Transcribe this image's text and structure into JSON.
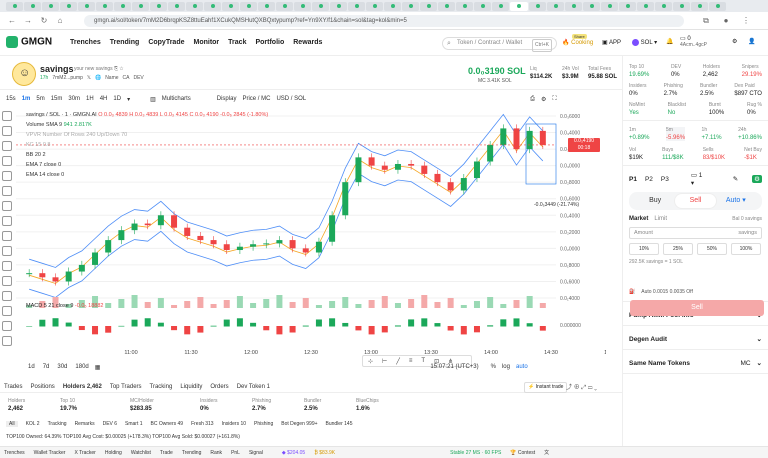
{
  "browser": {
    "url": "gmgn.ai/sol/token/7mM2D6brqpKSZ8ttuEahf1XCukQMSHutQXBQxtypump?ref=Yn9XY/f1&chain=sol&tag=kol&min=5",
    "tab_count": 40
  },
  "header": {
    "logo": "GMGN",
    "nav": [
      "Trenches",
      "Trending",
      "CopyTrade",
      "Monitor",
      "Track",
      "Portfolio",
      "Rewards"
    ],
    "search_placeholder": "Token / Contract / Wallet",
    "search_shortcut": "Ctrl+K",
    "cooking": "Cooking",
    "cooking_badge": "Share",
    "app": "APP",
    "chain": "SOL",
    "wallet_balance": "0",
    "wallet_name": "4Acm..4gcP"
  },
  "token": {
    "symbol": "savings",
    "description": "your new savings",
    "age": "17h",
    "creator": "7mM2...pump",
    "tags": [
      "Name",
      "CA",
      "DEV"
    ],
    "price": "0.0₀3190 SOL",
    "mc": "MC 3.41K SOL",
    "liq_label": "Liq",
    "liq": "$114.2K",
    "vol_label": "24h Vol",
    "vol": "$3.9M",
    "fees_label": "Total Fees",
    "fees": "95.88 SOL"
  },
  "chart": {
    "intervals": [
      "15s",
      "1m",
      "5m",
      "15m",
      "30m",
      "1H",
      "4H",
      "1D"
    ],
    "active_interval": "1m",
    "indicators_btn": "Multicharts",
    "display_btn": "Display",
    "price_mc": "Price / MC",
    "currency": "USD / SOL",
    "pair_line": "savings / SOL · 1 · GMGN.AI",
    "ohlc": "O 0.0₃ 4839  H 0.0₃ 4839  L 0.0₃ 4145  C 0.0₃ 4190  -0.0₆ 2845 (-1.80%)",
    "volume_label": "Volume SMA 9",
    "volume_vals": "941  2.817K",
    "vpvr_label": "VPVR Number Of Rows 240 Up/Down 70",
    "kc_label": "KC 15 0.8",
    "bb_label": "BB 20 2",
    "ema7_label": "EMA 7 close 0",
    "ema14_label": "EMA 14 close 0",
    "macd_label": "MACD 5 21 close 9",
    "macd_val": "-0.0₆ 18882",
    "price_badge_price": "0.0₃4190",
    "price_badge_time": "00:18",
    "annotation": "-0.0₅3449 (-21.74%)",
    "y_ticks": [
      "0.0₃6000",
      "0.0₃4000",
      "0.0₃2000",
      "0.0₃0000",
      "0.0₂8000",
      "0.0₂6000",
      "0.0₂4000",
      "0.0₂2000",
      "0.0₂0000",
      "0.0₁8000",
      "0.0₁6000",
      "0.0₁4000"
    ],
    "macd_tick": "0.000000",
    "x_ticks": [
      "11:00",
      "11:30",
      "12:00",
      "12:30",
      "13:00",
      "13:30",
      "14:00",
      "14:30",
      "15:00"
    ],
    "ranges": [
      "1d",
      "7d",
      "30d",
      "180d"
    ],
    "clock": "15:07:21 (UTC+3)",
    "scale_opts": [
      "%",
      "log",
      "auto"
    ],
    "price_points": [
      1.7e-06,
      1.65e-06,
      1.6e-06,
      1.72e-06,
      1.8e-06,
      1.95e-06,
      2.1e-06,
      2.22e-06,
      2.3e-06,
      2.28e-06,
      2.4e-06,
      2.25e-06,
      2.15e-06,
      2.1e-06,
      2.05e-06,
      1.98e-06,
      2.02e-06,
      2.05e-06,
      2.06e-06,
      2.1e-06,
      2e-06,
      1.95e-06,
      2.08e-06,
      2.4e-06,
      2.8e-06,
      3.1e-06,
      3e-06,
      2.95e-06,
      3.02e-06,
      3e-06,
      2.9e-06,
      2.8e-06,
      2.7e-06,
      2.85e-06,
      3.05e-06,
      3.25e-06,
      3.45e-06,
      3.2e-06,
      3.42e-06,
      3.25e-06
    ]
  },
  "bottom": {
    "tabs": [
      "Trades",
      "Positions",
      "Holders 2,462",
      "Top Traders",
      "Tracking",
      "Liquidity",
      "Orders",
      "Dev Token 1"
    ],
    "active_tab": "Holders 2,462",
    "instant_trade": "Instant trade",
    "stats": [
      {
        "label": "Holders",
        "value": "2,462"
      },
      {
        "label": "Top 10",
        "value": "19.7%"
      },
      {
        "label": "MC/Holder",
        "value": "$283.85"
      },
      {
        "label": "Insiders",
        "value": "0%"
      },
      {
        "label": "Phishing",
        "value": "2.7%"
      },
      {
        "label": "Bundler",
        "value": "2.5%"
      },
      {
        "label": "BlueChips",
        "value": "1.6%"
      }
    ],
    "filters": [
      "All",
      "KOL 2",
      "Tracking",
      "Remarks",
      "DEV 6",
      "Smart 1",
      "BC Owners 49",
      "Fresh 313",
      "Insiders 10",
      "Phishing",
      "Bot Degen 999+",
      "Bundler 145"
    ],
    "footer": "TOP100 Owned: 64.39%  TOP100 Avg Cost: $0.00025 (+178.3%)  TOP100 Avg Sold: $0.00027 (+161.8%)"
  },
  "status_bar": {
    "items": [
      "Trenches",
      "Wallet Tracker",
      "X Tracker",
      "Holding",
      "Watchlist",
      "Trade",
      "Trending",
      "Rank",
      "PnL",
      "Signal"
    ],
    "sol_price": "$204.05",
    "btc": "$83.9K",
    "stable": "Stable 27 MS · 60 FPS",
    "contest": "Contest",
    "lang": "文"
  },
  "right_panel": {
    "top_stats": [
      {
        "label": "Top 10",
        "value": "19.69%",
        "color": "green"
      },
      {
        "label": "DEV",
        "value": "0%"
      },
      {
        "label": "Holders",
        "value": "2,462"
      },
      {
        "label": "Snipers",
        "value": "29.19%",
        "color": "red"
      }
    ],
    "mid_stats": [
      {
        "label": "Insiders",
        "value": "0%"
      },
      {
        "label": "Phishing",
        "value": "2.7%"
      },
      {
        "label": "Bundler",
        "value": "2.5%"
      },
      {
        "label": "Dex Paid",
        "value": "$897 CTO"
      }
    ],
    "sec_stats": [
      {
        "label": "NoMint",
        "value": "Yes",
        "color": "green"
      },
      {
        "label": "Blacklist",
        "value": "No",
        "color": "green"
      },
      {
        "label": "Burnt",
        "value": "100%"
      },
      {
        "label": "Rug %",
        "value": "0%"
      }
    ],
    "timeframes": [
      {
        "label": "1m",
        "value": "+0.89%",
        "color": "green"
      },
      {
        "label": "5m",
        "value": "-5.96%",
        "color": "red"
      },
      {
        "label": "1h",
        "value": "+7.11%",
        "color": "green"
      },
      {
        "label": "24h",
        "value": "+10.86%",
        "color": "green"
      }
    ],
    "flows": [
      {
        "label": "Vol",
        "value": "$19K"
      },
      {
        "label": "Buys",
        "value": "111/$8K",
        "color": "green"
      },
      {
        "label": "Sells",
        "value": "83/$10K",
        "color": "red"
      },
      {
        "label": "Net Buy",
        "value": "-$1K",
        "color": "red"
      }
    ],
    "presets": [
      "P1",
      "P2",
      "P3"
    ],
    "buy": "Buy",
    "sell": "Sell",
    "auto": "Auto",
    "market": "Market",
    "limit": "Limit",
    "bal": "Bal 0 savings",
    "amount_label": "Amount",
    "amount_unit": "savings",
    "pcts": [
      "10%",
      "25%",
      "50%",
      "100%"
    ],
    "conversion": "292.5K savings = 1 SOL",
    "sell_btn": "Sell",
    "fee_line": "Auto  0.0015  0.0035  Off",
    "sections": [
      "Pump AMM Pool info",
      "Degen Audit",
      "Same Name Tokens"
    ],
    "same_name_filter": "MC"
  }
}
